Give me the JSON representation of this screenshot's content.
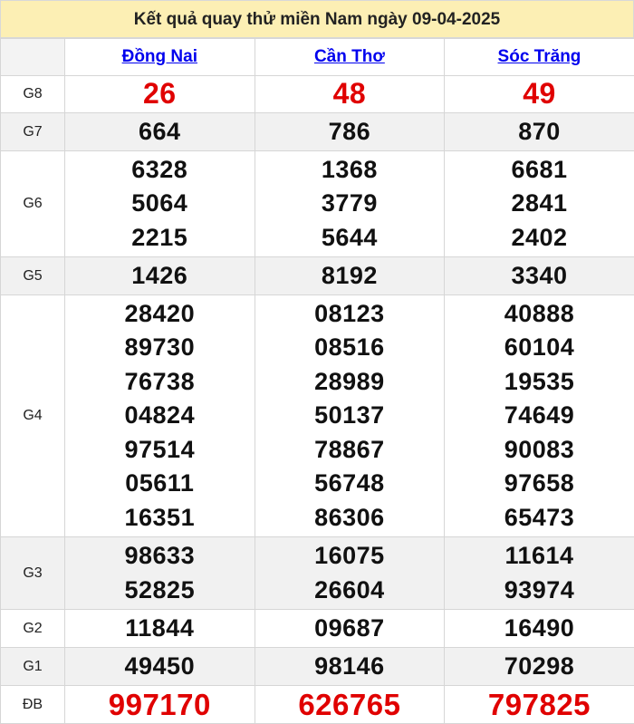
{
  "title": "Kết quả quay thử miền Nam ngày 09-04-2025",
  "provinces": [
    "Đồng Nai",
    "Cần Thơ",
    "Sóc Trăng"
  ],
  "prizes": [
    {
      "label": "G8",
      "values": [
        [
          "26"
        ],
        [
          "48"
        ],
        [
          "49"
        ]
      ]
    },
    {
      "label": "G7",
      "values": [
        [
          "664"
        ],
        [
          "786"
        ],
        [
          "870"
        ]
      ]
    },
    {
      "label": "G6",
      "values": [
        [
          "6328",
          "5064",
          "2215"
        ],
        [
          "1368",
          "3779",
          "5644"
        ],
        [
          "6681",
          "2841",
          "2402"
        ]
      ]
    },
    {
      "label": "G5",
      "values": [
        [
          "1426"
        ],
        [
          "8192"
        ],
        [
          "3340"
        ]
      ]
    },
    {
      "label": "G4",
      "values": [
        [
          "28420",
          "89730",
          "76738",
          "04824",
          "97514",
          "05611",
          "16351"
        ],
        [
          "08123",
          "08516",
          "28989",
          "50137",
          "78867",
          "56748",
          "86306"
        ],
        [
          "40888",
          "60104",
          "19535",
          "74649",
          "90083",
          "97658",
          "65473"
        ]
      ]
    },
    {
      "label": "G3",
      "values": [
        [
          "98633",
          "52825"
        ],
        [
          "16075",
          "26604"
        ],
        [
          "11614",
          "93974"
        ]
      ]
    },
    {
      "label": "G2",
      "values": [
        [
          "11844"
        ],
        [
          "09687"
        ],
        [
          "16490"
        ]
      ]
    },
    {
      "label": "G1",
      "values": [
        [
          "49450"
        ],
        [
          "98146"
        ],
        [
          "70298"
        ]
      ]
    },
    {
      "label": "ĐB",
      "values": [
        [
          "997170"
        ],
        [
          "626765"
        ],
        [
          "797825"
        ]
      ]
    }
  ],
  "colors": {
    "header_bg": "#fcefb4",
    "link": "#0000ee",
    "highlight": "#e00000",
    "alt_row": "#f1f1f1"
  }
}
